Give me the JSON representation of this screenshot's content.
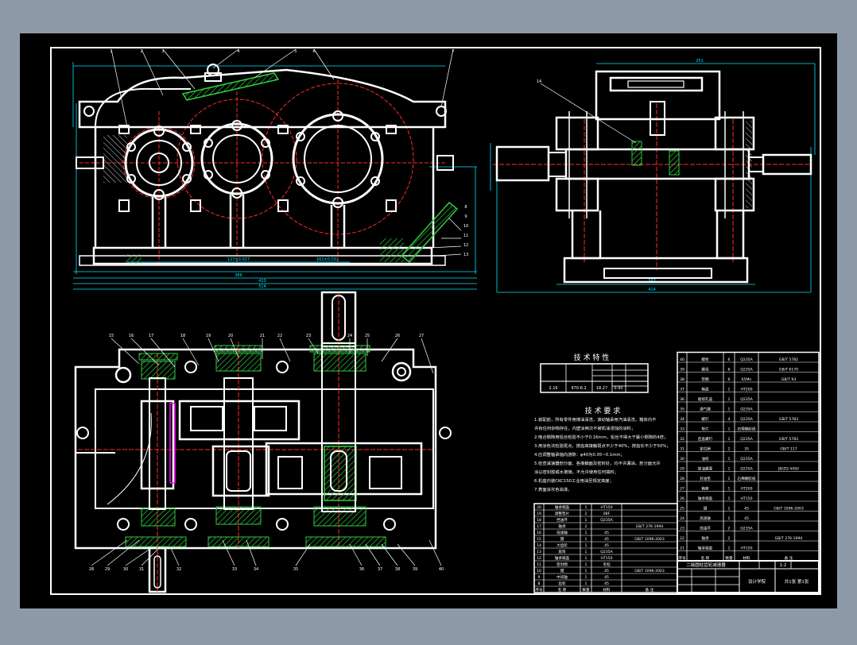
{
  "colors": {
    "backdrop": "#8e99a8",
    "paper": "#000000",
    "line": "#ffffff",
    "center": "#ff2a2a",
    "dim": "#00e5ff",
    "hatch": "#2ecc40",
    "accent": "#ff00ff",
    "yellow": "#ffff00"
  },
  "tech_chars": {
    "title": "技 术 特 性",
    "row": [
      "2.16",
      "970-6.2",
      "18.27",
      "0.95"
    ]
  },
  "tech_reqs": {
    "title": "技 术 要 求",
    "lines": [
      "1.装配前，所有零件用煤油清洗，滚动轴承用汽油清洗，箱体内不",
      "  许有任何杂物存在，内壁涂两次不被机油浸蚀的涂料；",
      "2.啮合侧隙用铅丝检验不小于0.16mm，铅丝不得大于最小侧隙的4倍；",
      "3.用涂色法检验斑点，按齿高接触斑点不少于40%，按齿长不少于50%；",
      "4.应调整轴承轴向游隙：φ40为0.05~0.1mm；",
      "5.检查减速器剖分面、各接触面及密封处，均不许漏油，剖分面允许",
      "  涂以密封胶或水玻璃，不允许使用任何填料；",
      "6.机座内装CKC150工业用油至规定高度；",
      "7.表面涂灰色油漆。"
    ]
  },
  "title_block": {
    "drawing_name": "二级圆柱齿轮减速器",
    "company": "设计学院",
    "scale": "1:2",
    "sheet": "共1张 第1张"
  },
  "balloons": {
    "front_top": [
      "1",
      "2",
      "3",
      "4",
      "5",
      "6",
      "7"
    ],
    "front_right": [
      "8",
      "9",
      "10",
      "11",
      "12",
      "13"
    ],
    "side_left": "14",
    "plan_top": [
      "15",
      "16",
      "17",
      "18",
      "19",
      "20",
      "21",
      "22",
      "23",
      "24",
      "25",
      "26",
      "27"
    ],
    "plan_bottom": [
      "28",
      "29",
      "30",
      "31",
      "32",
      "33",
      "34",
      "35",
      "36",
      "37",
      "38",
      "39",
      "40"
    ]
  },
  "parts_left": [
    [
      "20",
      "轴承端盖",
      "1",
      "HT150",
      ""
    ],
    [
      "19",
      "调整垫片",
      "2",
      "08F",
      ""
    ],
    [
      "18",
      "挡油环",
      "1",
      "Q235A",
      ""
    ],
    [
      "17",
      "轴承",
      "2",
      "",
      "GB/T 276-1994"
    ],
    [
      "16",
      "低速轴",
      "1",
      "45",
      ""
    ],
    [
      "15",
      "键",
      "1",
      "45",
      "GB/T 1096-2003"
    ],
    [
      "14",
      "大齿轮",
      "1",
      "45",
      ""
    ],
    [
      "13",
      "套筒",
      "1",
      "Q235A",
      ""
    ],
    [
      "12",
      "轴承端盖",
      "1",
      "HT150",
      ""
    ],
    [
      "11",
      "密封圈",
      "1",
      "毛毡",
      ""
    ],
    [
      "10",
      "键",
      "1",
      "45",
      "GB/T 1096-2003"
    ],
    [
      "9",
      "中间轴",
      "1",
      "45",
      ""
    ],
    [
      "8",
      "齿轮",
      "1",
      "45",
      ""
    ],
    [
      "序号",
      "名 称",
      "数量",
      "材料",
      "备 注"
    ]
  ],
  "parts_right": [
    [
      "40",
      "螺栓",
      "6",
      "Q235A",
      "GB/T 5782"
    ],
    [
      "39",
      "螺母",
      "6",
      "Q235A",
      "GB/T 6170"
    ],
    [
      "38",
      "垫圈",
      "6",
      "65Mn",
      "GB/T 93"
    ],
    [
      "37",
      "箱盖",
      "1",
      "HT200",
      ""
    ],
    [
      "36",
      "窥视孔盖",
      "1",
      "Q235A",
      ""
    ],
    [
      "35",
      "通气器",
      "1",
      "Q235A",
      ""
    ],
    [
      "34",
      "螺钉",
      "4",
      "Q235A",
      "GB/T 5783"
    ],
    [
      "33",
      "垫片",
      "1",
      "石棉橡胶纸",
      ""
    ],
    [
      "32",
      "启盖螺钉",
      "1",
      "Q235A",
      "GB/T 5783"
    ],
    [
      "31",
      "定位销",
      "2",
      "35",
      "GB/T 117"
    ],
    [
      "30",
      "油标",
      "1",
      "Q235A",
      ""
    ],
    [
      "29",
      "放油螺塞",
      "1",
      "Q235A",
      "JB/ZQ 4450"
    ],
    [
      "28",
      "封油垫",
      "1",
      "石棉橡胶纸",
      ""
    ],
    [
      "27",
      "箱座",
      "1",
      "HT200",
      ""
    ],
    [
      "26",
      "轴承端盖",
      "1",
      "HT150",
      ""
    ],
    [
      "25",
      "键",
      "1",
      "45",
      "GB/T 1096-2003"
    ],
    [
      "24",
      "高速轴",
      "1",
      "45",
      ""
    ],
    [
      "23",
      "挡油环",
      "2",
      "Q235A",
      ""
    ],
    [
      "22",
      "轴承",
      "2",
      "",
      "GB/T 276-1994"
    ],
    [
      "21",
      "轴承端盖",
      "1",
      "HT150",
      ""
    ],
    [
      "序号",
      "名 称",
      "数量",
      "材料",
      "备 注"
    ]
  ]
}
